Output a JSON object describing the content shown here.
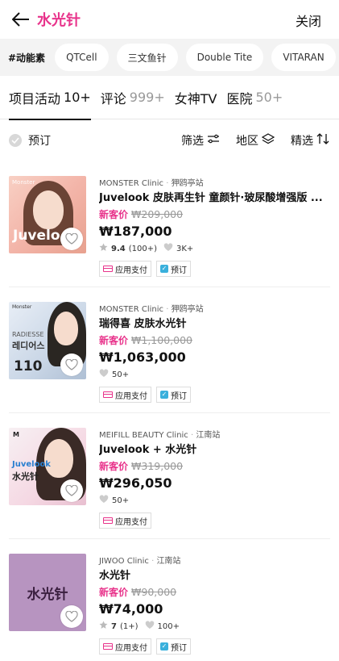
{
  "header": {
    "title": "水光针",
    "close_label": "关闭"
  },
  "chips": {
    "label": "#动能素",
    "items": [
      "QTCell",
      "三文鱼针",
      "Double Tite",
      "VITARAN"
    ]
  },
  "tabs": [
    {
      "label": "项目活动",
      "count": "10+"
    },
    {
      "label": "评论",
      "count": "999+"
    },
    {
      "label": "女神TV",
      "count": ""
    },
    {
      "label": "医院",
      "count": "50+"
    }
  ],
  "filters": {
    "reserve": "预订",
    "filter": "筛选",
    "region": "地区",
    "sort": "精选"
  },
  "items": [
    {
      "clinic": "MONSTER Clinic",
      "station": "狎鸥亭站",
      "name": "Juvelook 皮肤再生针 童颜针·玻尿酸增强版 ...",
      "new_tag": "新客价",
      "orig_price": "₩209,000",
      "price": "₩187,000",
      "rating": "9.4",
      "reviews": "(100+)",
      "likes": "3K+",
      "badges": [
        "应用支付",
        "预订"
      ],
      "thumb_text": "Juvelo",
      "thumb_small": "Monster"
    },
    {
      "clinic": "MONSTER Clinic",
      "station": "狎鸥亭站",
      "name": "瑞得喜 皮肤水光针",
      "new_tag": "新客价",
      "orig_price": "₩1,100,000",
      "price": "₩1,063,000",
      "likes": "50+",
      "badges": [
        "应用支付",
        "预订"
      ],
      "thumb_small": "Monster",
      "thumb_brand": "RADIESSE",
      "thumb_ko": "레디어스",
      "thumb_num": "110"
    },
    {
      "clinic": "MEIFILL BEAUTY Clinic",
      "station": "江南站",
      "name": "Juvelook + 水光针",
      "new_tag": "新客价",
      "orig_price": "₩319,000",
      "price": "₩296,050",
      "likes": "50+",
      "badges": [
        "应用支付"
      ],
      "thumb_brand": "Juvelook",
      "thumb_cn": "水光针"
    },
    {
      "clinic": "JIWOO Clinic",
      "station": "江南站",
      "name": "水光针",
      "new_tag": "新客价",
      "orig_price": "₩90,000",
      "price": "₩74,000",
      "rating": "7",
      "reviews": "(1+)",
      "likes": "100+",
      "badges": [
        "应用支付",
        "预订"
      ],
      "thumb_cn": "水光针"
    }
  ],
  "colors": {
    "accent": "#e8338b",
    "reserve_icon": "#3ab0dc",
    "thumb4": "#b794c0"
  }
}
